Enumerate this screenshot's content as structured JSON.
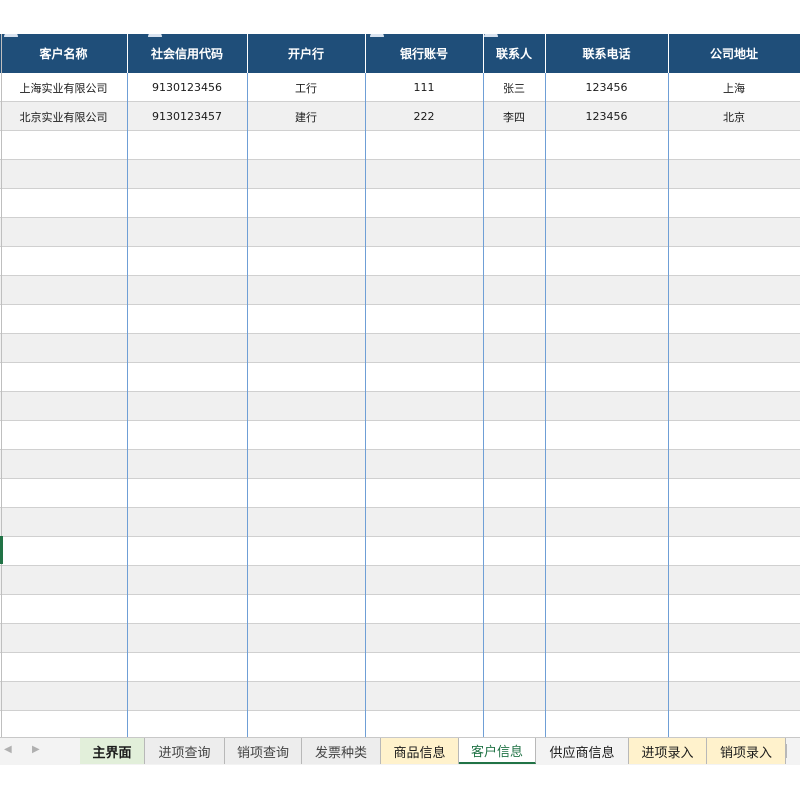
{
  "table": {
    "headers": [
      "客户名称",
      "社会信用代码",
      "开户行",
      "银行账号",
      "联系人",
      "联系电话",
      "公司地址"
    ],
    "rows": [
      [
        "上海实业有限公司",
        "9130123456",
        "工行",
        "111",
        "张三",
        "123456",
        "上海"
      ],
      [
        "北京实业有限公司",
        "9130123457",
        "建行",
        "222",
        "李四",
        "123456",
        "北京"
      ]
    ]
  },
  "tabs": [
    {
      "label": "主界面",
      "style": "green"
    },
    {
      "label": "进项查询",
      "style": "gray"
    },
    {
      "label": "销项查询",
      "style": "gray"
    },
    {
      "label": "发票种类",
      "style": "gray"
    },
    {
      "label": "商品信息",
      "style": "yellow"
    },
    {
      "label": "客户信息",
      "style": "active"
    },
    {
      "label": "供应商信息",
      "style": "plain"
    },
    {
      "label": "进项录入",
      "style": "yellow"
    },
    {
      "label": "销项录入",
      "style": "yellow"
    }
  ],
  "nav_icons": [
    "chevron-left-icon",
    "chevron-right-icon"
  ],
  "colors": {
    "header_bg": "#1f4e79",
    "column_line": "#6f9fd6",
    "stripe": "#f0f0f0",
    "active_tab": "#217346",
    "tab_green": "#e2efda",
    "tab_yellow": "#fff2cc"
  }
}
